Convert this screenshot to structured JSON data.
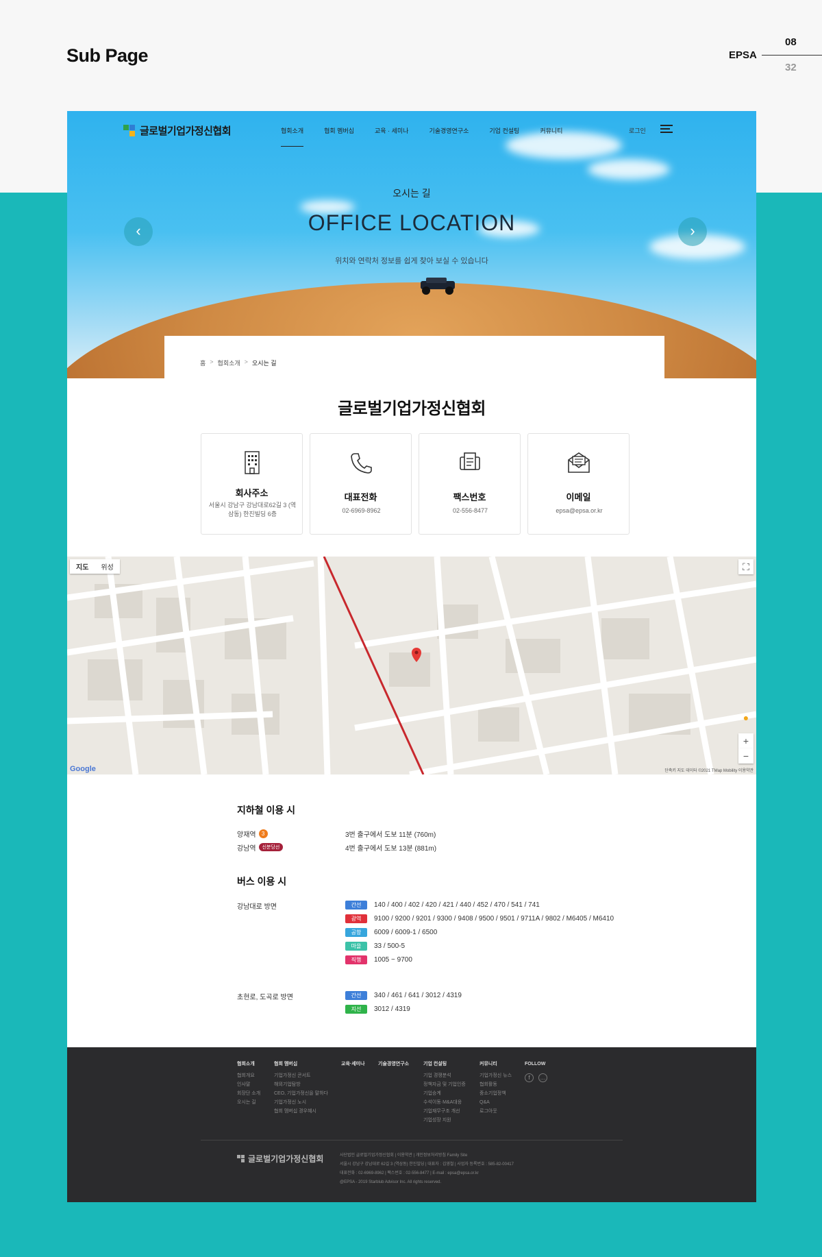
{
  "page": {
    "title": "Sub Page",
    "brand": "EPSA",
    "current": "08",
    "total": "32"
  },
  "header": {
    "logo": "글로벌기업가정신협회",
    "nav": [
      "협회소개",
      "협회 멤버십",
      "교육 · 세미나",
      "기술경영연구소",
      "기업 컨설팅",
      "커뮤니티"
    ],
    "login": "로그인"
  },
  "hero": {
    "sub": "오시는 길",
    "title": "OFFICE LOCATION",
    "desc": "위치와 연락처 정보를 쉽게 찾아 보실 수 있습니다",
    "prev_icon": "chevron-left-icon",
    "next_icon": "chevron-right-icon"
  },
  "breadcrumb": [
    "홈",
    "협회소개",
    "오시는 길"
  ],
  "org_title": "글로벌기업가정신협회",
  "cards": [
    {
      "icon": "building-icon",
      "label": "회사주소",
      "value": "서울시 강남구 강남대로62길 3 (역삼동) 한진빌딩 6층"
    },
    {
      "icon": "phone-icon",
      "label": "대표전화",
      "value": "02-6969-8962"
    },
    {
      "icon": "fax-icon",
      "label": "팩스번호",
      "value": "02-556-8477"
    },
    {
      "icon": "mail-icon",
      "label": "이메일",
      "value": "epsa@epsa.or.kr"
    }
  ],
  "map": {
    "tab_map": "지도",
    "tab_sat": "위성",
    "google": "Google",
    "copyright": "단축키  지도 데이터 ©2021 TMap Mobility  이용약관"
  },
  "subway": {
    "title": "지하철 이용 시",
    "rows": [
      {
        "station": "양재역",
        "line": "3",
        "desc": "3번 출구에서 도보 11분 (760m)"
      },
      {
        "station": "강남역",
        "line": "신분당선",
        "desc": "4번 출구에서 도보 13분 (881m)"
      }
    ]
  },
  "bus": {
    "title": "버스 이용 시",
    "groups": [
      {
        "place": "강남대로 방면",
        "rows": [
          {
            "type": "간선",
            "color": "#3d7fd9",
            "routes": "140 / 400 / 402 / 420 / 421 / 440 / 452 / 470 / 541 / 741"
          },
          {
            "type": "광역",
            "color": "#e0303a",
            "routes": "9100 / 9200 / 9201 / 9300 / 9408 / 9500 / 9501 / 9711A / 9802 / M6405 / M6410"
          },
          {
            "type": "공항",
            "color": "#37a6dd",
            "routes": "6009 / 6009-1 / 6500"
          },
          {
            "type": "마을",
            "color": "#3cc2a8",
            "routes": "33 / 500-5"
          },
          {
            "type": "직행",
            "color": "#e2336b",
            "routes": "1005 ~ 9700"
          }
        ]
      },
      {
        "place": "초현로, 도곡로 방면",
        "rows": [
          {
            "type": "간선",
            "color": "#3d7fd9",
            "routes": "340 / 461 / 641 / 3012 / 4319"
          },
          {
            "type": "지선",
            "color": "#2fb34a",
            "routes": "3012 / 4319"
          }
        ]
      }
    ]
  },
  "footer": {
    "cols": [
      {
        "title": "협회소개",
        "items": [
          "협회개요",
          "인사말",
          "회장단 소개",
          "오시는 길"
        ]
      },
      {
        "title": "협회 멤버십",
        "items": [
          "기업가정신 콘서트",
          "해외기업탐방",
          "CEO, 기업가정신을 말하다",
          "기업가정신 노시",
          "협회 멤버십 경우혜시"
        ]
      },
      {
        "title": "교육·세미나",
        "items": []
      },
      {
        "title": "기술경영연구소",
        "items": []
      },
      {
        "title": "기업 컨설팅",
        "items": [
          "기업 경쟁분석",
          "정책자금 및 기업인증",
          "기업승계",
          "수석이동·M&A대응",
          "기업재무구조 개선",
          "기업성장 지원"
        ]
      },
      {
        "title": "커뮤니티",
        "items": [
          "기업가정신 뉴스",
          "협회활동",
          "중소기업정책",
          "Q&A",
          "로그아웃"
        ]
      },
      {
        "title": "FOLLOW",
        "items": []
      }
    ],
    "logo": "글로벌기업가정신협회",
    "info": [
      "사단법인 글로벌기업가정신협회  |  이용약관  |  개인정보처리방침    Family Site",
      "서울시 강남구 강남대로 62길 3 (역삼동) 한진빌딩  |  대표자 : 김영철  |  사업자 등록번호 : 585-82-00417",
      "대표전화 : 02-6969-8962  |  팩스번호 : 02-556-8477  |  E-mail : epsa@epsa.or.kr",
      "@EPSA - 2019 Starblub Advisor Inc. All rights reserved."
    ],
    "sns": [
      "facebook-icon",
      "talk-icon"
    ]
  }
}
